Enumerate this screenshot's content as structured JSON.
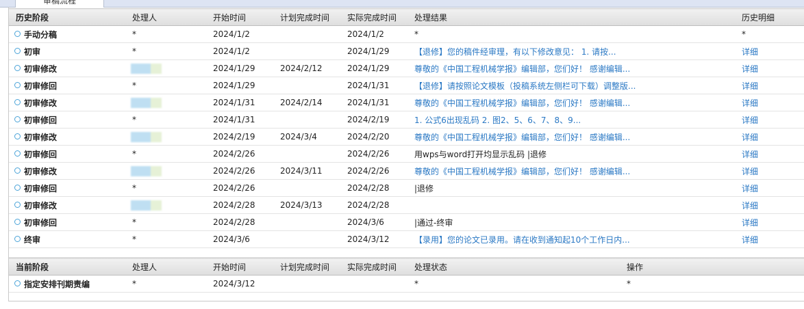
{
  "top_tab": "审稿流程",
  "history": {
    "headers": [
      "历史阶段",
      "处理人",
      "开始时间",
      "计划完成时间",
      "实际完成时间",
      "处理结果",
      "历史明细"
    ],
    "rows": [
      {
        "stage": "手动分稿",
        "handler": "*",
        "start": "2024/1/2",
        "plan": "",
        "actual": "2024/1/2",
        "result": "*",
        "detail": "*",
        "blurred": false,
        "result_link": false,
        "detail_link": false
      },
      {
        "stage": "初审",
        "handler": "*",
        "start": "2024/1/2",
        "plan": "",
        "actual": "2024/1/29",
        "result": "【退修】您的稿件经审理，有以下修改意见： 1. 请按...",
        "detail": "详细",
        "blurred": false,
        "result_link": true,
        "detail_link": true
      },
      {
        "stage": "初审修改",
        "handler": "",
        "start": "2024/1/29",
        "plan": "2024/2/12",
        "actual": "2024/1/29",
        "result": "尊敬的《中国工程机械学报》编辑部，您们好！ 感谢编辑...",
        "detail": "详细",
        "blurred": true,
        "result_link": true,
        "detail_link": true
      },
      {
        "stage": "初审修回",
        "handler": "*",
        "start": "2024/1/29",
        "plan": "",
        "actual": "2024/1/31",
        "result": "【退修】请按照论文模板（投稿系统左侧栏可下载）调整版...",
        "detail": "详细",
        "blurred": false,
        "result_link": true,
        "detail_link": true
      },
      {
        "stage": "初审修改",
        "handler": "",
        "start": "2024/1/31",
        "plan": "2024/2/14",
        "actual": "2024/1/31",
        "result": "尊敬的《中国工程机械学报》编辑部，您们好！ 感谢编辑...",
        "detail": "详细",
        "blurred": true,
        "result_link": true,
        "detail_link": true
      },
      {
        "stage": "初审修回",
        "handler": "*",
        "start": "2024/1/31",
        "plan": "",
        "actual": "2024/2/19",
        "result": "1. 公式6出现乱码 2. 图2、5、6、7、8、9...",
        "detail": "详细",
        "blurred": false,
        "result_link": true,
        "detail_link": true
      },
      {
        "stage": "初审修改",
        "handler": "",
        "start": "2024/2/19",
        "plan": "2024/3/4",
        "actual": "2024/2/20",
        "result": "尊敬的《中国工程机械学报》编辑部，您们好！ 感谢编辑...",
        "detail": "详细",
        "blurred": true,
        "result_link": true,
        "detail_link": true
      },
      {
        "stage": "初审修回",
        "handler": "*",
        "start": "2024/2/26",
        "plan": "",
        "actual": "2024/2/26",
        "result": "用wps与word打开均显示乱码 |退修",
        "detail": "详细",
        "blurred": false,
        "result_link": false,
        "detail_link": true
      },
      {
        "stage": "初审修改",
        "handler": "",
        "start": "2024/2/26",
        "plan": "2024/3/11",
        "actual": "2024/2/26",
        "result": "尊敬的《中国工程机械学报》编辑部，您们好！ 感谢编辑...",
        "detail": "详细",
        "blurred": true,
        "result_link": true,
        "detail_link": true
      },
      {
        "stage": "初审修回",
        "handler": "*",
        "start": "2024/2/26",
        "plan": "",
        "actual": "2024/2/28",
        "result": "|退修",
        "detail": "详细",
        "blurred": false,
        "result_link": false,
        "detail_link": true
      },
      {
        "stage": "初审修改",
        "handler": "",
        "start": "2024/2/28",
        "plan": "2024/3/13",
        "actual": "2024/2/28",
        "result": "",
        "detail": "详细",
        "blurred": true,
        "result_link": false,
        "detail_link": true
      },
      {
        "stage": "初审修回",
        "handler": "*",
        "start": "2024/2/28",
        "plan": "",
        "actual": "2024/3/6",
        "result": "|通过-终审",
        "detail": "详细",
        "blurred": false,
        "result_link": false,
        "detail_link": true
      },
      {
        "stage": "终审",
        "handler": "*",
        "start": "2024/3/6",
        "plan": "",
        "actual": "2024/3/12",
        "result": "【录用】您的论文已录用。请在收到通知起10个工作日内...",
        "detail": "详细",
        "blurred": false,
        "result_link": true,
        "detail_link": true
      }
    ]
  },
  "current": {
    "headers": [
      "当前阶段",
      "处理人",
      "开始时间",
      "计划完成时间",
      "实际完成时间",
      "处理状态",
      "操作"
    ],
    "rows": [
      {
        "stage": "指定安排刊期责编",
        "handler": "*",
        "start": "2024/3/12",
        "plan": "",
        "actual": "",
        "status": "*",
        "op": "*"
      }
    ]
  }
}
